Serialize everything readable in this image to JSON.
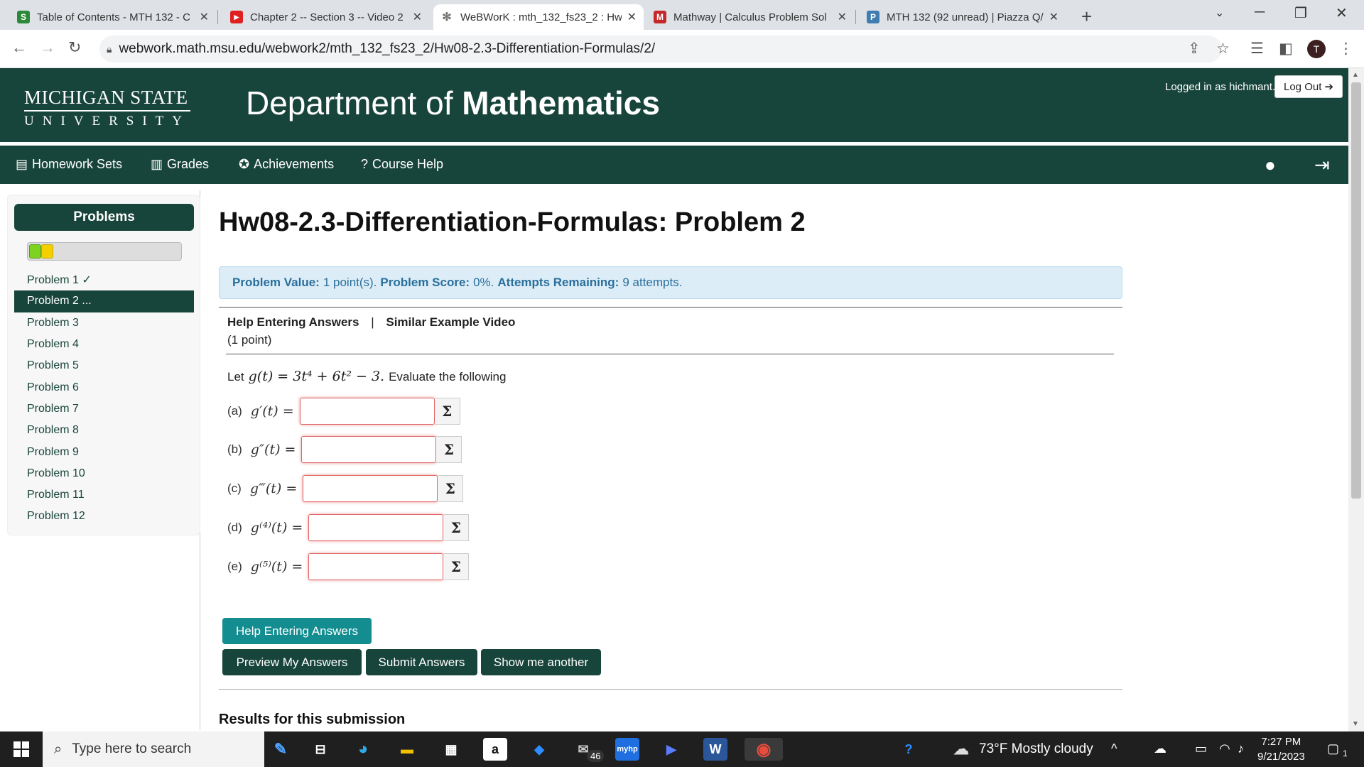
{
  "browser": {
    "tabs": [
      {
        "title": "Table of Contents - MTH 132 - C",
        "icon": "s-icon",
        "color": "#2a8a3a"
      },
      {
        "title": "Chapter 2 -- Section 3 -- Video 2",
        "icon": "youtube-icon",
        "color": "#e02020"
      },
      {
        "title": "WeBWorK : mth_132_fs23_2 : Hw",
        "icon": "webwork-icon",
        "color": "#888888"
      },
      {
        "title": "Mathway | Calculus Problem Sol",
        "icon": "mathway-icon",
        "color": "#c62828"
      },
      {
        "title": "MTH 132 (92 unread) | Piazza Q/",
        "icon": "piazza-icon",
        "color": "#3e7cb1"
      }
    ],
    "active_tab": 2,
    "url": "webwork.math.msu.edu/webwork2/mth_132_fs23_2/Hw08-2.3-Differentiation-Formulas/2/",
    "profile_initial": "T"
  },
  "header": {
    "msu_line1": "MICHIGAN STATE",
    "msu_line2": "UNIVERSITY",
    "dept_prefix": "Department of",
    "dept_bold": "Mathematics",
    "logged_in": "Logged in as hichmant.",
    "logout": "Log Out"
  },
  "nav": {
    "homework_sets": "Homework Sets",
    "grades": "Grades",
    "achievements": "Achievements",
    "course_help": "Course Help"
  },
  "sidebar": {
    "heading": "Problems",
    "progress": {
      "completed": 1,
      "current": 1,
      "total": 12
    },
    "items": [
      {
        "label": "Problem 1 ✓"
      },
      {
        "label": "Problem 2 ..."
      },
      {
        "label": "Problem 3"
      },
      {
        "label": "Problem 4"
      },
      {
        "label": "Problem 5"
      },
      {
        "label": "Problem 6"
      },
      {
        "label": "Problem 7"
      },
      {
        "label": "Problem 8"
      },
      {
        "label": "Problem 9"
      },
      {
        "label": "Problem 10"
      },
      {
        "label": "Problem 11"
      },
      {
        "label": "Problem 12"
      }
    ],
    "active_index": 1
  },
  "main": {
    "title": "Hw08-2.3-Differentiation-Formulas: Problem 2",
    "info": {
      "value_label": "Problem Value:",
      "value": "1 point(s).",
      "score_label": "Problem Score:",
      "score": "0%.",
      "attempts_label": "Attempts Remaining:",
      "attempts": "9 attempts."
    },
    "help_link": "Help Entering Answers",
    "separator": "|",
    "video_link": "Similar Example Video",
    "points": "(1 point)",
    "prompt_prefix": "Let",
    "function": "g(t) = 3t⁴ + 6t² − 3.",
    "prompt_suffix": "Evaluate the following",
    "parts": [
      {
        "label": "(a)",
        "expr": "g′(t) =",
        "value": ""
      },
      {
        "label": "(b)",
        "expr": "g″(t) =",
        "value": ""
      },
      {
        "label": "(c)",
        "expr": "g‴(t) =",
        "value": ""
      },
      {
        "label": "(d)",
        "expr": "g⁽⁴⁾(t) =",
        "value": ""
      },
      {
        "label": "(e)",
        "expr": "g⁽⁵⁾(t) =",
        "value": ""
      }
    ],
    "sigma": "Σ",
    "buttons": {
      "help": "Help Entering Answers",
      "preview": "Preview My Answers",
      "submit": "Submit Answers",
      "another": "Show me another"
    },
    "results_heading": "Results for this submission"
  },
  "taskbar": {
    "search_placeholder": "Type here to search",
    "mail_badge": "46",
    "weather": "73°F  Mostly cloudy",
    "time": "7:27 PM",
    "date": "9/21/2023",
    "notifications": "1"
  }
}
